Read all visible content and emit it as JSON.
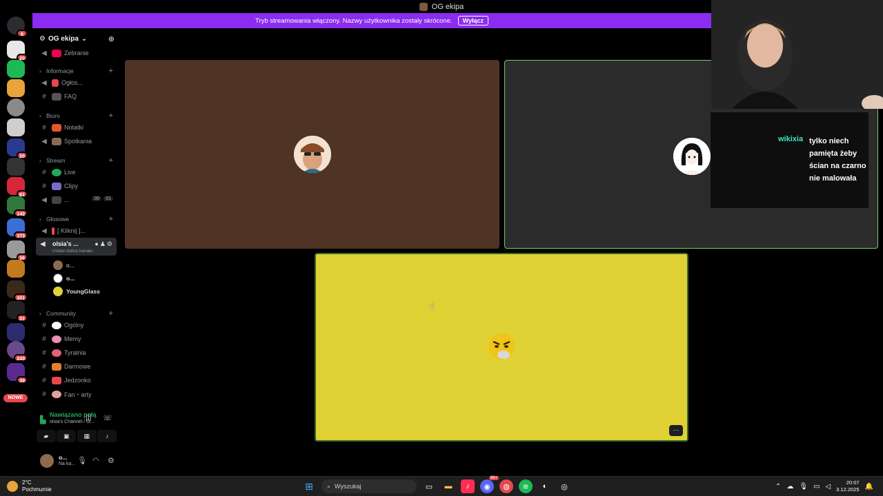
{
  "window": {
    "title": "OG ekipa"
  },
  "banner": {
    "text": "Tryb streamowania włączony. Nazwy użytkownika zostały skrócone.",
    "button": "Wyłącz"
  },
  "rail": {
    "badges": [
      "8",
      "20",
      "20",
      "61",
      "142",
      "373",
      "36",
      "201",
      "21",
      "243",
      "39"
    ],
    "new_label": "NOWE"
  },
  "server": {
    "name": "OG ekipa"
  },
  "channels": {
    "top": {
      "name": "Zebranie"
    },
    "cat_info": "Informacje",
    "info": [
      "Ogłos...",
      "FAQ"
    ],
    "cat_biuro": "Biuro",
    "biuro": [
      "Notatki",
      "Spotkania"
    ],
    "cat_stream": "Stream",
    "stream": [
      "Live",
      "Clipy",
      "..."
    ],
    "timers": [
      "00",
      "01"
    ],
    "cat_glosowe": "Głosowe",
    "glosowe": [
      "[ Kliknij ]..."
    ],
    "active_voice": {
      "name": "olsia's ...",
      "status": "Ustaw status kanału"
    },
    "members": [
      "o...",
      "o...",
      "YoungGlass"
    ],
    "cat_community": "Community",
    "community": [
      "Ogólny",
      "Memy",
      "Tyralnia",
      "Darmowe",
      "Jedzonko",
      "Fan・arty"
    ]
  },
  "voice_panel": {
    "status": "Nawiązano połą",
    "channel": "olsia's Channel / O..."
  },
  "user_panel": {
    "name": "o...",
    "status": "Na ka..."
  },
  "stage": {
    "more": "···"
  },
  "chat": {
    "author": "wikixia",
    "message": "tylko niech pamięta żeby ścian na czarno nie malowała"
  },
  "taskbar": {
    "temp": "2°C",
    "condition": "Pochmurnie",
    "search_placeholder": "Wyszukaj",
    "time": "20:07",
    "date": "3.12.2025",
    "discord_badge": "99+"
  },
  "colors": {
    "banner": "#8b2cf0",
    "tile_brown": "#4f3325",
    "tile_dark": "#2b2b2b",
    "tile_yellow": "#e0d134",
    "speaking": "#6fcf6f",
    "chat_author": "#3ee4c9"
  }
}
